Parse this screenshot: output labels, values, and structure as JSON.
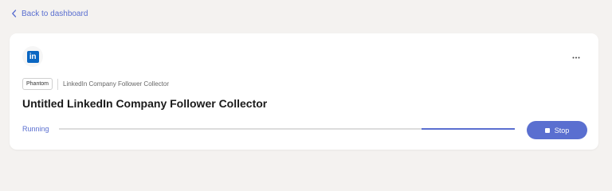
{
  "nav": {
    "back_label": "Back to dashboard"
  },
  "card": {
    "logo_text": "in",
    "badge_label": "Phantom",
    "template_name": "LinkedIn Company Follower Collector",
    "title": "Untitled LinkedIn Company Follower Collector",
    "status": "Running",
    "progress": {
      "segment_start": 0.795,
      "segment_end": 1.0
    },
    "stop_label": "Stop"
  },
  "colors": {
    "accent": "#5a6fd0",
    "brand": "#0a66c2",
    "background": "#f4f2f0"
  },
  "icons": {
    "back": "chevron-left-icon",
    "menu": "more-horizontal-icon",
    "stop": "stop-square-icon"
  }
}
